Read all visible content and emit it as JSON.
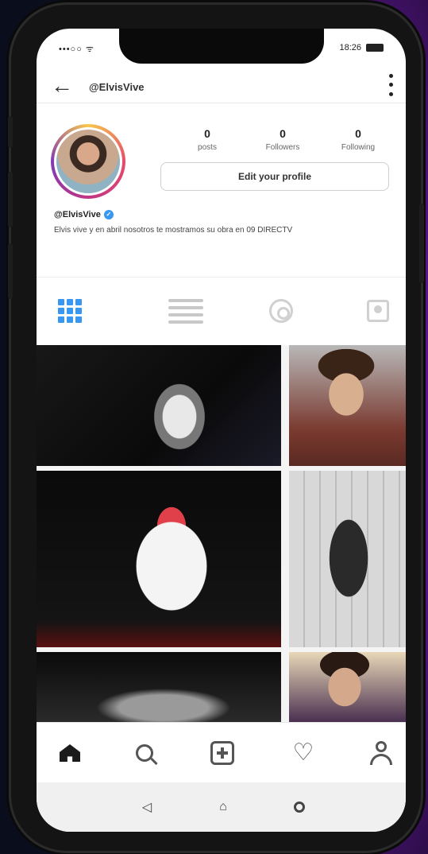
{
  "status_bar": {
    "carrier": "•••○○ ᯤ",
    "time": "18:26"
  },
  "header": {
    "handle": "@ElvisVive"
  },
  "profile": {
    "stats": [
      {
        "count": "0",
        "label": "posts"
      },
      {
        "count": "0",
        "label": "Followers"
      },
      {
        "count": "0",
        "label": "Following"
      }
    ],
    "edit_label": "Edit your profile",
    "username": "@ElvisVive",
    "bio": "Elvis vive y en abril nosotros te mostramos su obra en 09 DIRECTV"
  },
  "icons": {
    "back": "back-arrow-icon",
    "more": "kebab-menu-icon",
    "grid": "grid-icon",
    "list": "list-icon",
    "reels": "reels-icon",
    "tagged": "tagged-icon",
    "home": "home-icon",
    "search": "search-icon",
    "add": "add-post-icon",
    "activity": "heart-icon",
    "profile": "profile-icon"
  },
  "colors": {
    "accent": "#3897f0",
    "background_purple": "#7a1fb0"
  }
}
